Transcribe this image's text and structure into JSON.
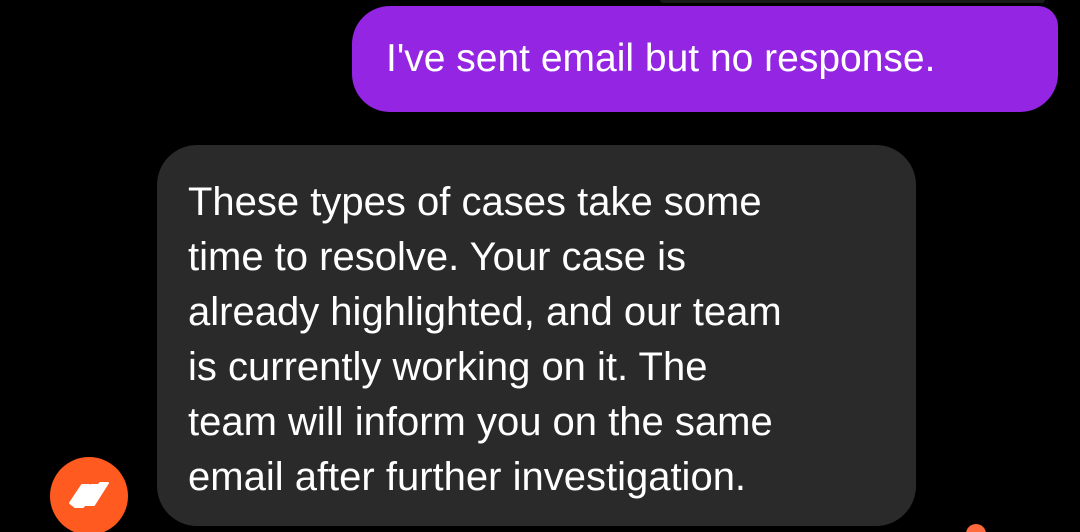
{
  "conversation": {
    "messages": [
      {
        "sender": "user",
        "text": "I've sent email but no response."
      },
      {
        "sender": "agent",
        "lines": [
          "These types of cases take some",
          "time to resolve. Your case is",
          "already highlighted, and our team",
          "is currently working on it. The",
          "team will inform you on the same",
          "email after further investigation."
        ]
      }
    ]
  },
  "colors": {
    "background": "#000000",
    "outgoing_bubble": "#9325e3",
    "incoming_bubble": "#2a2a2a",
    "avatar_bg": "#ff5a1f",
    "reaction_dot": "#ff6a3d"
  },
  "icons": {
    "avatar": "brand-logo-icon",
    "reaction": "reaction-indicator-icon"
  }
}
